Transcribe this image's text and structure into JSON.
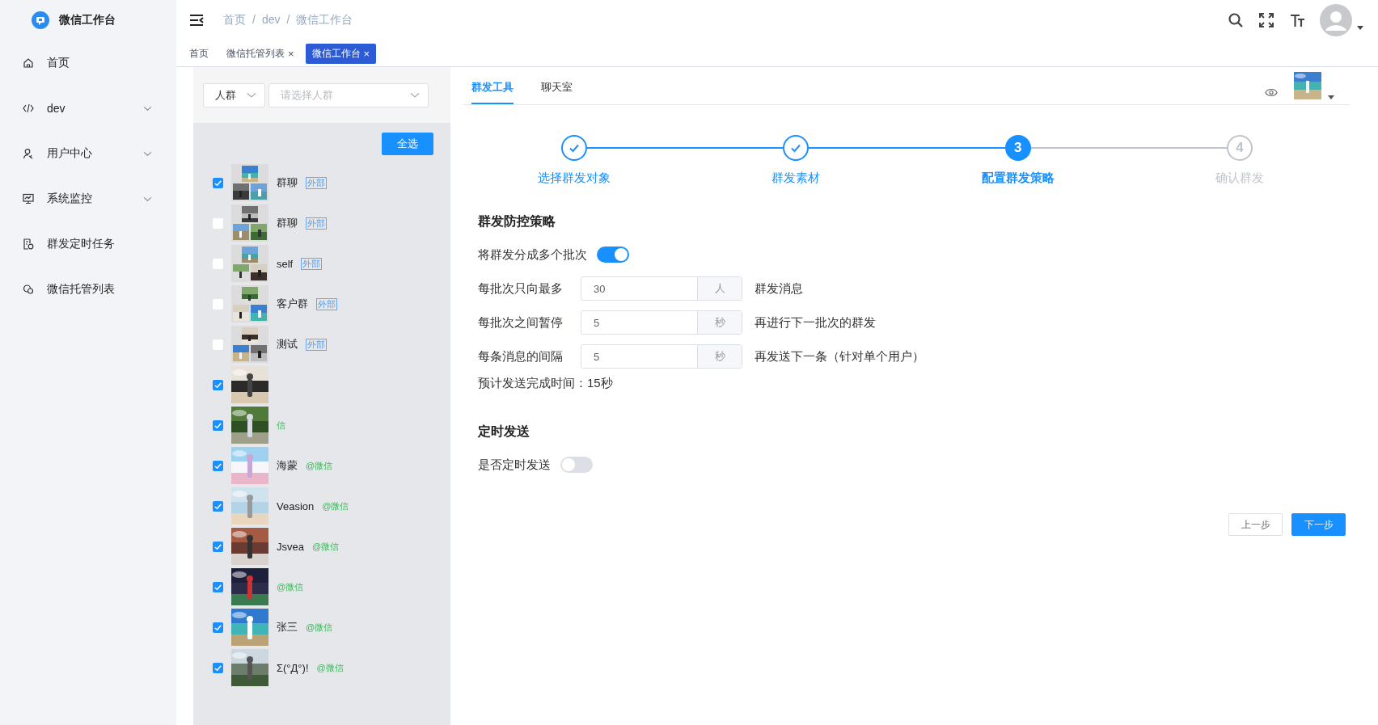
{
  "sidebar": {
    "logo_text": "微信工作台",
    "items": [
      {
        "label": "首页",
        "expandable": false
      },
      {
        "label": "dev",
        "expandable": true
      },
      {
        "label": "用户中心",
        "expandable": true
      },
      {
        "label": "系统监控",
        "expandable": true
      },
      {
        "label": "群发定时任务",
        "expandable": false
      },
      {
        "label": "微信托管列表",
        "expandable": false
      }
    ]
  },
  "header": {
    "breadcrumb": [
      "首页",
      "dev",
      "微信工作台"
    ],
    "separator": "/"
  },
  "tabs": [
    {
      "label": "首页",
      "selected": false,
      "closable": false
    },
    {
      "label": "微信托管列表",
      "selected": false,
      "closable": true
    },
    {
      "label": "微信工作台",
      "selected": true,
      "closable": true
    }
  ],
  "close_glyph": "×",
  "filter": {
    "type_select": "人群",
    "group_select_placeholder": "请选择人群"
  },
  "select_all_button": "全选",
  "contacts": [
    {
      "kind": "group",
      "name": "群聊",
      "tag": "外部",
      "checked": true
    },
    {
      "kind": "group",
      "name": "群聊",
      "tag": "外部",
      "checked": false
    },
    {
      "kind": "group",
      "name": "self",
      "tag": "外部",
      "checked": false
    },
    {
      "kind": "group",
      "name": "客户群",
      "tag": "外部",
      "checked": false
    },
    {
      "kind": "group",
      "name": "测试",
      "tag": "外部",
      "checked": false
    },
    {
      "kind": "single",
      "checked": true
    },
    {
      "kind": "single",
      "tag": "信",
      "checked": true
    },
    {
      "kind": "single",
      "name": "海蒙",
      "tag": "@微信",
      "checked": true
    },
    {
      "kind": "single",
      "name": "Veasion",
      "tag": "@微信",
      "checked": true
    },
    {
      "kind": "single",
      "name": "Jsvea",
      "tag": "@微信",
      "checked": true
    },
    {
      "kind": "single",
      "tag": "@微信",
      "checked": true
    },
    {
      "kind": "single",
      "name": "张三",
      "tag": "@微信",
      "checked": true
    },
    {
      "kind": "single",
      "name": "Σ(°Д°)!",
      "tag": "@微信",
      "checked": true
    }
  ],
  "panel_tabs": [
    {
      "label": "群发工具",
      "selected": true
    },
    {
      "label": "聊天室",
      "selected": false
    }
  ],
  "steps": [
    {
      "label": "选择群发对象",
      "done": true,
      "active": false
    },
    {
      "label": "群发素材",
      "done": true,
      "active": false
    },
    {
      "label": "配置群发策略",
      "number": "3",
      "done": false,
      "active": true
    },
    {
      "label": "确认群发",
      "number": "4",
      "done": false,
      "active": false
    }
  ],
  "strategy": {
    "title": "群发防控策略",
    "split": {
      "label": "将群发分成多个批次",
      "on": true
    },
    "rows": [
      {
        "label": "每批次只向最多",
        "value": "30",
        "unit": "人",
        "suffix": "群发消息"
      },
      {
        "label": "每批次之间暂停",
        "value": "5",
        "unit": "秒",
        "suffix": "再进行下一批次的群发"
      },
      {
        "label": "每条消息的间隔",
        "value": "5",
        "unit": "秒",
        "suffix": "再发送下一条（针对单个用户）"
      }
    ],
    "estimate": "预计发送完成时间：15秒"
  },
  "schedule": {
    "title": "定时发送",
    "toggle": {
      "label": "是否定时发送",
      "on": false
    }
  },
  "buttons": [
    {
      "label": "上一步",
      "kind": "default"
    },
    {
      "label": "下一步",
      "kind": "primary"
    }
  ]
}
